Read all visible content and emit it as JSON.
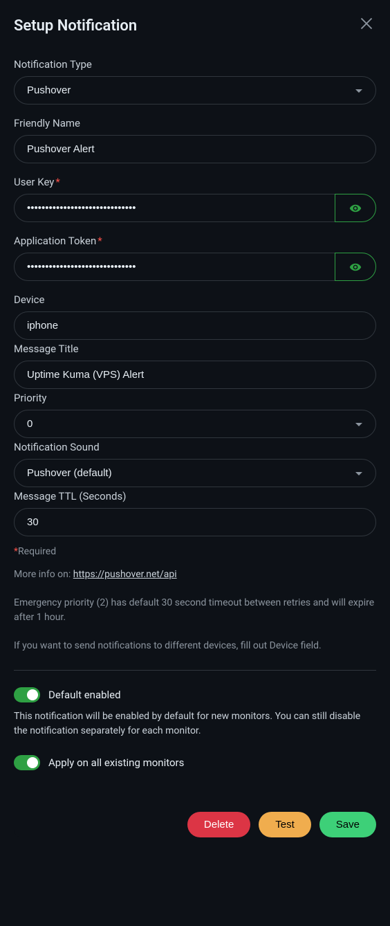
{
  "modal": {
    "title": "Setup Notification"
  },
  "fields": {
    "notification_type": {
      "label": "Notification Type",
      "value": "Pushover"
    },
    "friendly_name": {
      "label": "Friendly Name",
      "value": "Pushover Alert"
    },
    "user_key": {
      "label": "User Key",
      "value": "••••••••••••••••••••••••••••••"
    },
    "application_token": {
      "label": "Application Token",
      "value": "••••••••••••••••••••••••••••••"
    },
    "device": {
      "label": "Device",
      "value": "iphone"
    },
    "message_title": {
      "label": "Message Title",
      "value": "Uptime Kuma (VPS) Alert"
    },
    "priority": {
      "label": "Priority",
      "value": "0"
    },
    "notification_sound": {
      "label": "Notification Sound",
      "value": "Pushover (default)"
    },
    "message_ttl": {
      "label": "Message TTL (Seconds)",
      "value": "30"
    }
  },
  "help": {
    "required_label": "Required",
    "more_info_prefix": "More info on: ",
    "more_info_link": "https://pushover.net/api",
    "emergency_note": "Emergency priority (2) has default 30 second timeout between retries and will expire after 1 hour.",
    "device_note": "If you want to send notifications to different devices, fill out Device field."
  },
  "toggles": {
    "default_enabled": {
      "label": "Default enabled",
      "description": "This notification will be enabled by default for new monitors. You can still disable the notification separately for each monitor.",
      "on": true
    },
    "apply_all": {
      "label": "Apply on all existing monitors",
      "on": true
    }
  },
  "buttons": {
    "delete": "Delete",
    "test": "Test",
    "save": "Save"
  }
}
